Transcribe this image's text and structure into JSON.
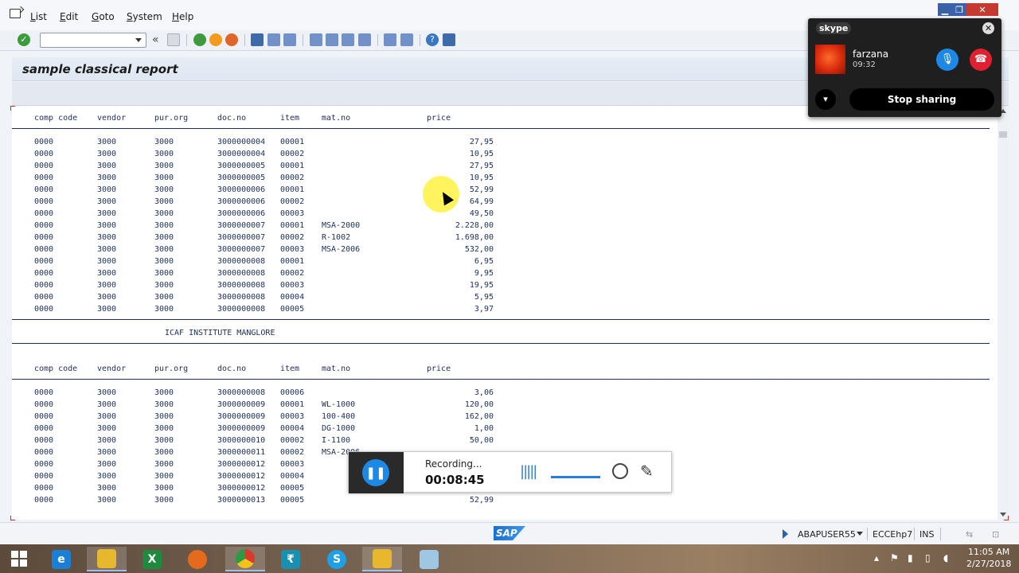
{
  "menu": {
    "items": [
      "List",
      "Edit",
      "Goto",
      "System",
      "Help"
    ]
  },
  "toolbar": {
    "command_value": ""
  },
  "report": {
    "title": "sample classical report",
    "headers": [
      "comp code",
      "vendor",
      "pur.org",
      "doc.no",
      "item",
      "mat.no",
      "price"
    ],
    "block1": [
      [
        "0000",
        "3000",
        "3000",
        "3000000004",
        "00001",
        "",
        "27,95"
      ],
      [
        "0000",
        "3000",
        "3000",
        "3000000004",
        "00002",
        "",
        "10,95"
      ],
      [
        "0000",
        "3000",
        "3000",
        "3000000005",
        "00001",
        "",
        "27,95"
      ],
      [
        "0000",
        "3000",
        "3000",
        "3000000005",
        "00002",
        "",
        "10,95"
      ],
      [
        "0000",
        "3000",
        "3000",
        "3000000006",
        "00001",
        "",
        "52,99"
      ],
      [
        "0000",
        "3000",
        "3000",
        "3000000006",
        "00002",
        "",
        "64,99"
      ],
      [
        "0000",
        "3000",
        "3000",
        "3000000006",
        "00003",
        "",
        "49,50"
      ],
      [
        "0000",
        "3000",
        "3000",
        "3000000007",
        "00001",
        "MSA-2000",
        "2.228,00"
      ],
      [
        "0000",
        "3000",
        "3000",
        "3000000007",
        "00002",
        "R-1002",
        "1.698,00"
      ],
      [
        "0000",
        "3000",
        "3000",
        "3000000007",
        "00003",
        "MSA-2006",
        "532,00"
      ],
      [
        "0000",
        "3000",
        "3000",
        "3000000008",
        "00001",
        "",
        "6,95"
      ],
      [
        "0000",
        "3000",
        "3000",
        "3000000008",
        "00002",
        "",
        "9,95"
      ],
      [
        "0000",
        "3000",
        "3000",
        "3000000008",
        "00003",
        "",
        "19,95"
      ],
      [
        "0000",
        "3000",
        "3000",
        "3000000008",
        "00004",
        "",
        "5,95"
      ],
      [
        "0000",
        "3000",
        "3000",
        "3000000008",
        "00005",
        "",
        "3,97"
      ]
    ],
    "page_title": "ICAF INSTITUTE MANGLORE",
    "block2": [
      [
        "0000",
        "3000",
        "3000",
        "3000000008",
        "00006",
        "",
        "3,06"
      ],
      [
        "0000",
        "3000",
        "3000",
        "3000000009",
        "00001",
        "WL-1000",
        "120,00"
      ],
      [
        "0000",
        "3000",
        "3000",
        "3000000009",
        "00003",
        "100-400",
        "162,00"
      ],
      [
        "0000",
        "3000",
        "3000",
        "3000000009",
        "00004",
        "DG-1000",
        "1,00"
      ],
      [
        "0000",
        "3000",
        "3000",
        "3000000010",
        "00002",
        "I-1100",
        "50,00"
      ],
      [
        "0000",
        "3000",
        "3000",
        "3000000011",
        "00002",
        "MSA-2006",
        ""
      ],
      [
        "0000",
        "3000",
        "3000",
        "3000000012",
        "00003",
        "",
        ""
      ],
      [
        "0000",
        "3000",
        "3000",
        "3000000012",
        "00004",
        "",
        ""
      ],
      [
        "0000",
        "3000",
        "3000",
        "3000000012",
        "00005",
        "",
        ""
      ],
      [
        "0000",
        "3000",
        "3000",
        "3000000013",
        "00005",
        "",
        "52,99"
      ]
    ]
  },
  "statusbar": {
    "logo": "SAP",
    "user": "ABAPUSER55",
    "system": "ECCEhp7",
    "mode": "INS"
  },
  "skype": {
    "brand": "skype",
    "caller": "farzana",
    "duration": "09:32",
    "stop_label": "Stop sharing"
  },
  "recorder": {
    "status": "Recording...",
    "elapsed": "00:08:45"
  },
  "taskbar": {
    "time": "11:05 AM",
    "date": "2/27/2018"
  },
  "colors": {
    "report_text": "#1c2e5a",
    "skype_bg": "#1f1f1f",
    "accent_blue": "#1e88e5",
    "hangup_red": "#e02030"
  }
}
